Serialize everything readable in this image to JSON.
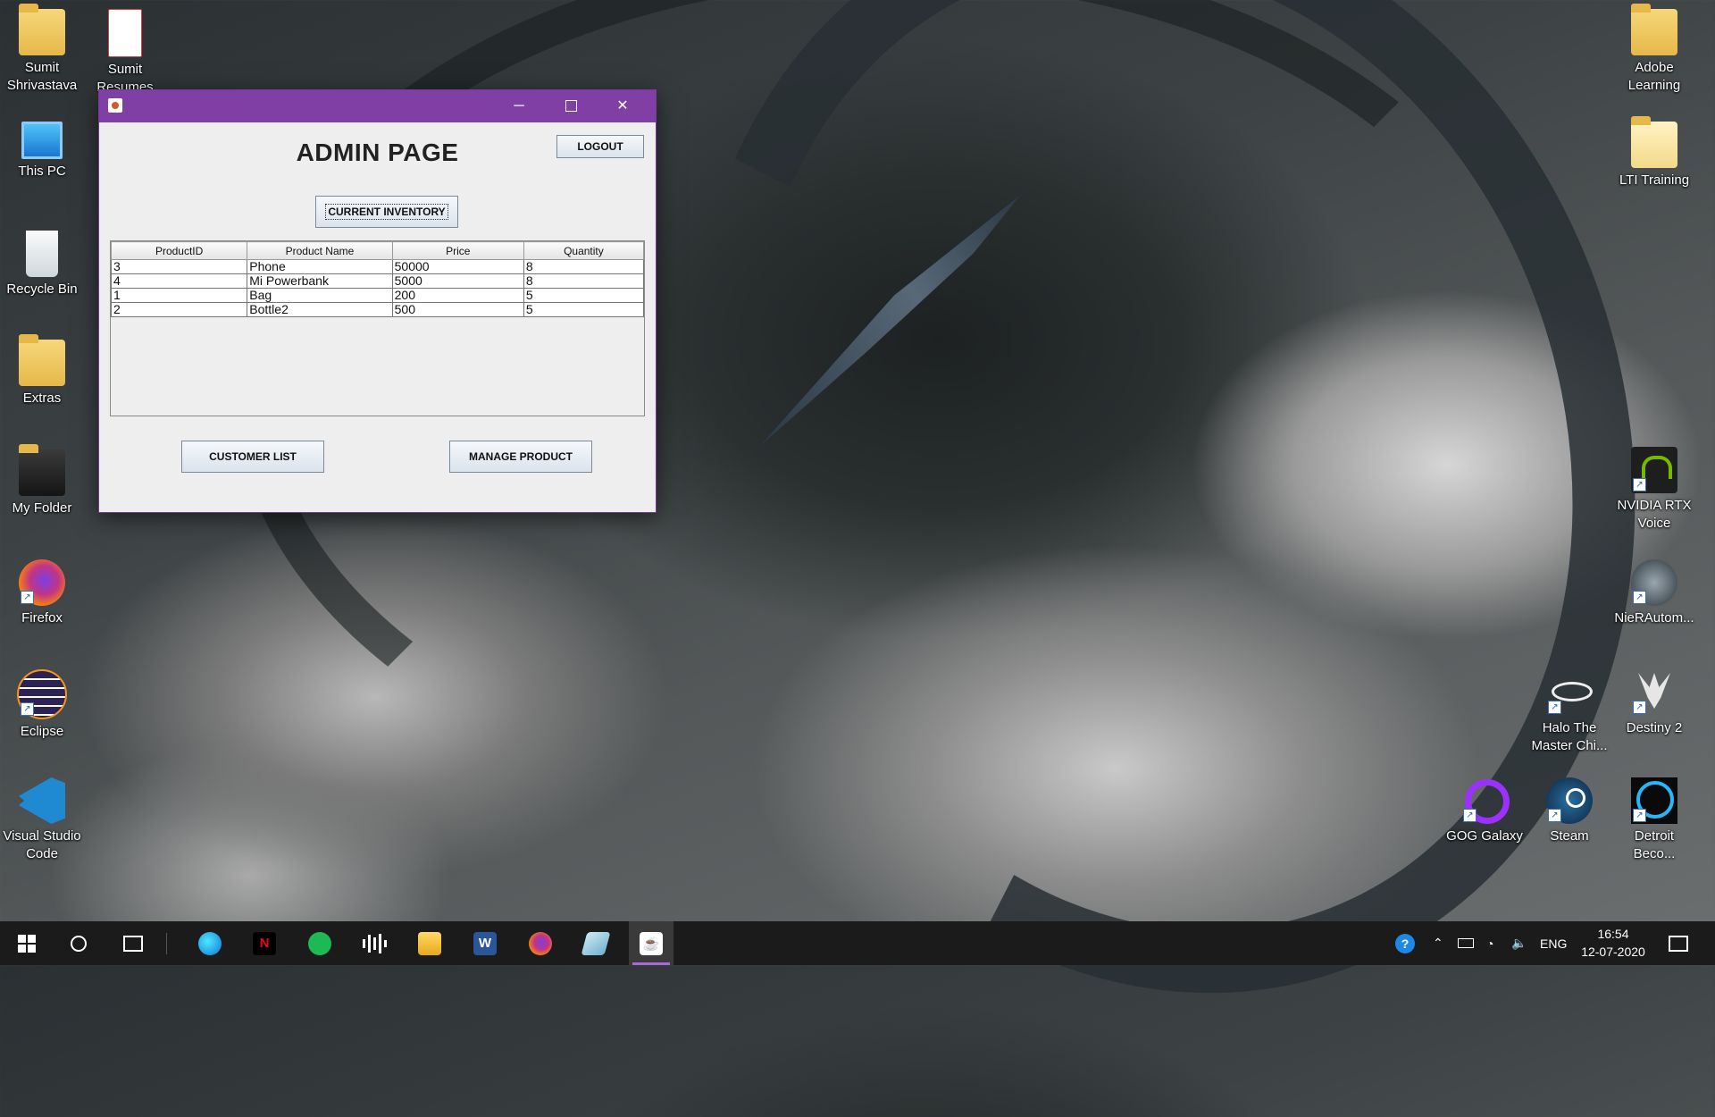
{
  "desktop": {
    "left_icons": [
      {
        "name": "sumit-shrivastava",
        "label": "Sumit\nShrivastava"
      },
      {
        "name": "sumit-resume",
        "label": "Sumit\nResumes"
      },
      {
        "name": "this-pc",
        "label": "This PC"
      },
      {
        "name": "recycle-bin",
        "label": "Recycle Bin"
      },
      {
        "name": "extras",
        "label": "Extras"
      },
      {
        "name": "my-folder",
        "label": "My Folder"
      },
      {
        "name": "firefox",
        "label": "Firefox"
      },
      {
        "name": "eclipse",
        "label": "Eclipse"
      },
      {
        "name": "vscode",
        "label": "Visual Studio\nCode"
      }
    ],
    "right_icons": [
      {
        "name": "adobe-learning",
        "label": "Adobe\nLearning"
      },
      {
        "name": "lti-training",
        "label": "LTI Training"
      },
      {
        "name": "nvidia-rtx-voice",
        "label": "NVIDIA RTX\nVoice"
      },
      {
        "name": "nier-automata",
        "label": "NieRAutom..."
      },
      {
        "name": "halo",
        "label": "Halo The\nMaster Chi..."
      },
      {
        "name": "destiny2",
        "label": "Destiny 2"
      },
      {
        "name": "gog-galaxy",
        "label": "GOG Galaxy"
      },
      {
        "name": "steam",
        "label": "Steam"
      },
      {
        "name": "detroit",
        "label": "Detroit\nBeco..."
      }
    ]
  },
  "window": {
    "title": "ADMIN PAGE",
    "logout_label": "LOGOUT",
    "inventory_label": "CURRENT INVENTORY",
    "customer_list_label": "CUSTOMER LIST",
    "manage_product_label": "MANAGE PRODUCT",
    "controls": {
      "minimize": "─",
      "close": "✕"
    },
    "table": {
      "headers": [
        "ProductID",
        "Product Name",
        "Price",
        "Quantity"
      ],
      "rows": [
        [
          "3",
          "Phone",
          "50000",
          "8"
        ],
        [
          "4",
          "Mi Powerbank",
          "5000",
          "8"
        ],
        [
          "1",
          "Bag",
          "200",
          "5"
        ],
        [
          "2",
          "Bottle2",
          "500",
          "5"
        ]
      ]
    }
  },
  "taskbar": {
    "language": "ENG",
    "time": "16:54",
    "date": "12-07-2020",
    "colors": {
      "accent": "#a66bd6",
      "window_titlebar": "#7f3fa5"
    }
  }
}
